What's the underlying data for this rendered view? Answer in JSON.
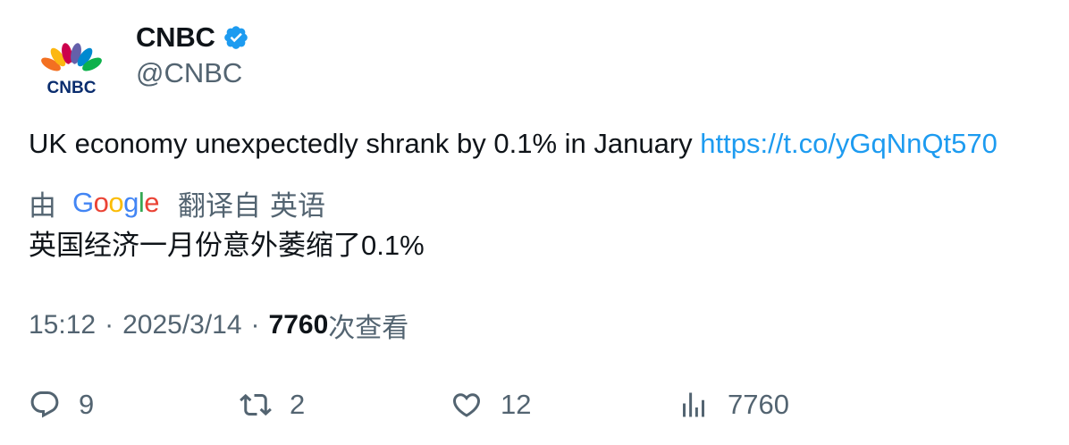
{
  "author": {
    "display_name": "CNBC",
    "handle": "@CNBC",
    "avatar_icon": "cnbc-peacock-logo",
    "avatar_logo_text": "CNBC",
    "verified_icon": "verified-badge-icon",
    "verified_color": "#1d9bf0"
  },
  "tweet": {
    "text": "UK economy unexpectedly shrank by 0.1% in January ",
    "link": "https://t.co/yGqNnQt570",
    "link_color": "#1d9bf0"
  },
  "translation": {
    "by_label": "由",
    "provider_logo": "Google",
    "translated_from": "翻译自",
    "source_language": "英语",
    "translated_text": "英国经济一月份意外萎缩了0.1%"
  },
  "meta": {
    "time": "15:12",
    "separator": "·",
    "date": "2025/3/14",
    "views": "7760",
    "views_suffix": "次查看"
  },
  "actions": {
    "reply_count": "9",
    "retweet_count": "2",
    "like_count": "12",
    "views_count": "7760",
    "reply_icon": "reply-icon",
    "retweet_icon": "retweet-icon",
    "like_icon": "heart-icon",
    "views_icon": "analytics-icon"
  },
  "colors": {
    "text_primary": "#0f1419",
    "text_secondary": "#536471"
  }
}
